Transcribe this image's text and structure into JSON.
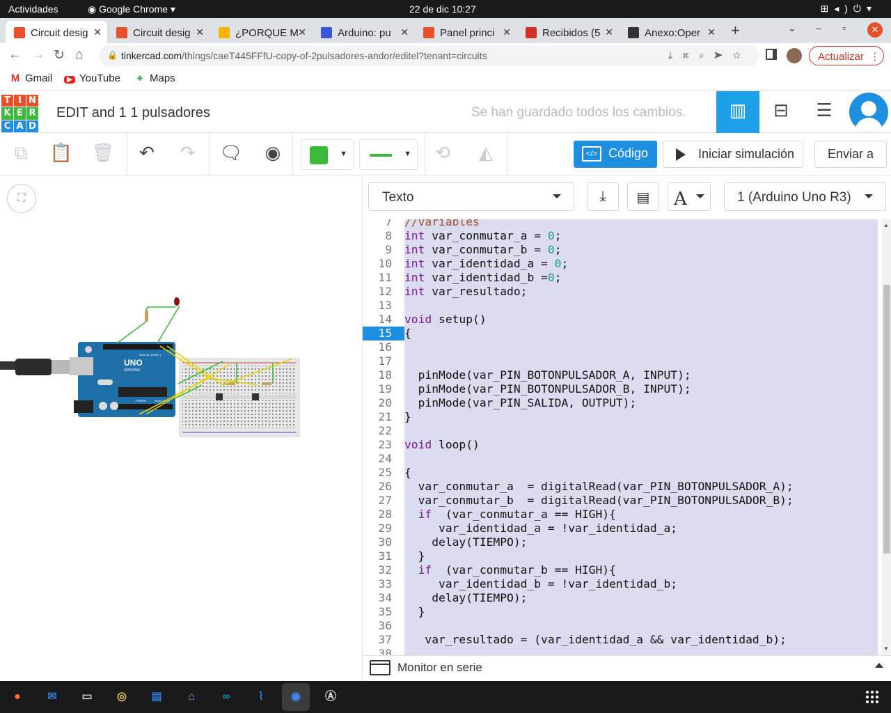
{
  "system": {
    "activities": "Actividades",
    "app_name": "Google Chrome",
    "clock": "22 de dic  10:27"
  },
  "tabs": [
    {
      "label": "Circuit desig",
      "favicon_color": "#e8502a",
      "active": true
    },
    {
      "label": "Circuit desig",
      "favicon_color": "#e8502a",
      "active": false
    },
    {
      "label": "¿PORQUE M",
      "favicon_color": "#f5b400",
      "active": false
    },
    {
      "label": "Arduino: pu",
      "favicon_color": "#3a55d9",
      "active": false
    },
    {
      "label": "Panel princi",
      "favicon_color": "#e8502a",
      "active": false
    },
    {
      "label": "Recibidos (5",
      "favicon_color": "#d93025",
      "active": false
    },
    {
      "label": "Anexo:Oper",
      "favicon_color": "#333333",
      "active": false
    }
  ],
  "address": {
    "domain": "tinkercad.com",
    "path": "/things/caeT445FFfU-copy-of-2pulsadores-andor/editel?tenant=circuits",
    "update_label": "Actualizar"
  },
  "bookmarks": [
    {
      "label": "Gmail",
      "icon": "gmail-icon"
    },
    {
      "label": "YouTube",
      "icon": "youtube-icon"
    },
    {
      "label": "Maps",
      "icon": "maps-icon"
    }
  ],
  "tinkercad": {
    "logo_letters": [
      "T",
      "I",
      "N",
      "K",
      "E",
      "R",
      "C",
      "A",
      "D"
    ],
    "logo_colors": [
      "#e8502a",
      "#e8502a",
      "#e8502a",
      "#3cba3c",
      "#3cba3c",
      "#3cba3c",
      "#1d8fe0",
      "#1d8fe0",
      "#1d8fe0"
    ],
    "project_title": "EDIT and 1 1 pulsadores",
    "save_status": "Se han guardado todos los cambios."
  },
  "toolbar": {
    "code_label": "Código",
    "simulate_label": "Iniciar simulación",
    "send_label": "Enviar a",
    "component_color": "#3cba3c"
  },
  "code_panel": {
    "mode": "Texto",
    "device": "1 (Arduino Uno R3)",
    "serial_label": "Monitor en serie",
    "current_line": 15,
    "lines": [
      {
        "n": "7",
        "c": [
          [
            "cm",
            "//variables"
          ]
        ]
      },
      {
        "n": "8",
        "c": [
          [
            "kw",
            "int"
          ],
          [
            "",
            " var_conmutar_a = "
          ],
          [
            "nm",
            "0"
          ],
          [
            "",
            ";"
          ]
        ]
      },
      {
        "n": "9",
        "c": [
          [
            "kw",
            "int"
          ],
          [
            "",
            " var_conmutar_b = "
          ],
          [
            "nm",
            "0"
          ],
          [
            "",
            ";"
          ]
        ]
      },
      {
        "n": "10",
        "c": [
          [
            "kw",
            "int"
          ],
          [
            "",
            " var_identidad_a = "
          ],
          [
            "nm",
            "0"
          ],
          [
            "",
            ";"
          ]
        ]
      },
      {
        "n": "11",
        "c": [
          [
            "kw",
            "int"
          ],
          [
            "",
            " var_identidad_b ="
          ],
          [
            "nm",
            "0"
          ],
          [
            "",
            ";"
          ]
        ]
      },
      {
        "n": "12",
        "c": [
          [
            "kw",
            "int"
          ],
          [
            "",
            " var_resultado;"
          ]
        ]
      },
      {
        "n": "13",
        "c": []
      },
      {
        "n": "14",
        "c": [
          [
            "kw",
            "void"
          ],
          [
            "",
            " setup()"
          ]
        ]
      },
      {
        "n": "15",
        "c": [
          [
            "",
            "{"
          ]
        ]
      },
      {
        "n": "16",
        "c": []
      },
      {
        "n": "17",
        "c": []
      },
      {
        "n": "18",
        "c": [
          [
            "",
            "  pinMode(var_PIN_BOTONPULSADOR_A, INPUT);"
          ]
        ]
      },
      {
        "n": "19",
        "c": [
          [
            "",
            "  pinMode(var_PIN_BOTONPULSADOR_B, INPUT);"
          ]
        ]
      },
      {
        "n": "20",
        "c": [
          [
            "",
            "  pinMode(var_PIN_SALIDA, OUTPUT);"
          ]
        ]
      },
      {
        "n": "21",
        "c": [
          [
            "",
            "}"
          ]
        ]
      },
      {
        "n": "22",
        "c": []
      },
      {
        "n": "23",
        "c": [
          [
            "kw",
            "void"
          ],
          [
            "",
            " loop()"
          ]
        ]
      },
      {
        "n": "24",
        "c": []
      },
      {
        "n": "25",
        "c": [
          [
            "",
            "{"
          ]
        ]
      },
      {
        "n": "26",
        "c": [
          [
            "",
            "  var_conmutar_a  = digitalRead(var_PIN_BOTONPULSADOR_A);"
          ]
        ]
      },
      {
        "n": "27",
        "c": [
          [
            "",
            "  var_conmutar_b  = digitalRead(var_PIN_BOTONPULSADOR_B);"
          ]
        ]
      },
      {
        "n": "28",
        "c": [
          [
            "",
            "  "
          ],
          [
            "kw",
            "if"
          ],
          [
            "",
            "  (var_conmutar_a == HIGH){"
          ]
        ]
      },
      {
        "n": "29",
        "c": [
          [
            "",
            "     var_identidad_a = !var_identidad_a;"
          ]
        ]
      },
      {
        "n": "30",
        "c": [
          [
            "",
            "    delay(TIEMPO);"
          ]
        ]
      },
      {
        "n": "31",
        "c": [
          [
            "",
            "  }"
          ]
        ]
      },
      {
        "n": "32",
        "c": [
          [
            "",
            "  "
          ],
          [
            "kw",
            "if"
          ],
          [
            "",
            "  (var_conmutar_b == HIGH){"
          ]
        ]
      },
      {
        "n": "33",
        "c": [
          [
            "",
            "     var_identidad_b = !var_identidad_b;"
          ]
        ]
      },
      {
        "n": "34",
        "c": [
          [
            "",
            "    delay(TIEMPO);"
          ]
        ]
      },
      {
        "n": "35",
        "c": [
          [
            "",
            "  }"
          ]
        ]
      },
      {
        "n": "36",
        "c": []
      },
      {
        "n": "37",
        "c": [
          [
            "",
            "   var_resultado = (var_identidad_a && var_identidad_b);"
          ]
        ]
      },
      {
        "n": "38",
        "c": []
      }
    ]
  },
  "circuit": {
    "board_label": "UNO",
    "board_brand": "ARDUINO",
    "board_header": "DIGITAL (PWM~)",
    "board_power": "POWER",
    "board_analog": "ANALOG IN"
  },
  "dock": [
    {
      "icon": "firefox-icon",
      "color": "#ff7139"
    },
    {
      "icon": "thunderbird-icon",
      "color": "#2a7ad9"
    },
    {
      "icon": "files-icon",
      "color": "#cfcfcf"
    },
    {
      "icon": "rhythmbox-icon",
      "color": "#e9c84a"
    },
    {
      "icon": "libreoffice-writer-icon",
      "color": "#2a7ad9"
    },
    {
      "icon": "software-icon",
      "color": "#6aa5e8"
    },
    {
      "icon": "arduino-ide-icon",
      "color": "#00979c"
    },
    {
      "icon": "system-monitor-icon",
      "color": "#2a7ad9"
    },
    {
      "icon": "chrome-icon",
      "color": "#4285f4"
    },
    {
      "icon": "inkscape-icon",
      "color": "#dddddd"
    }
  ]
}
